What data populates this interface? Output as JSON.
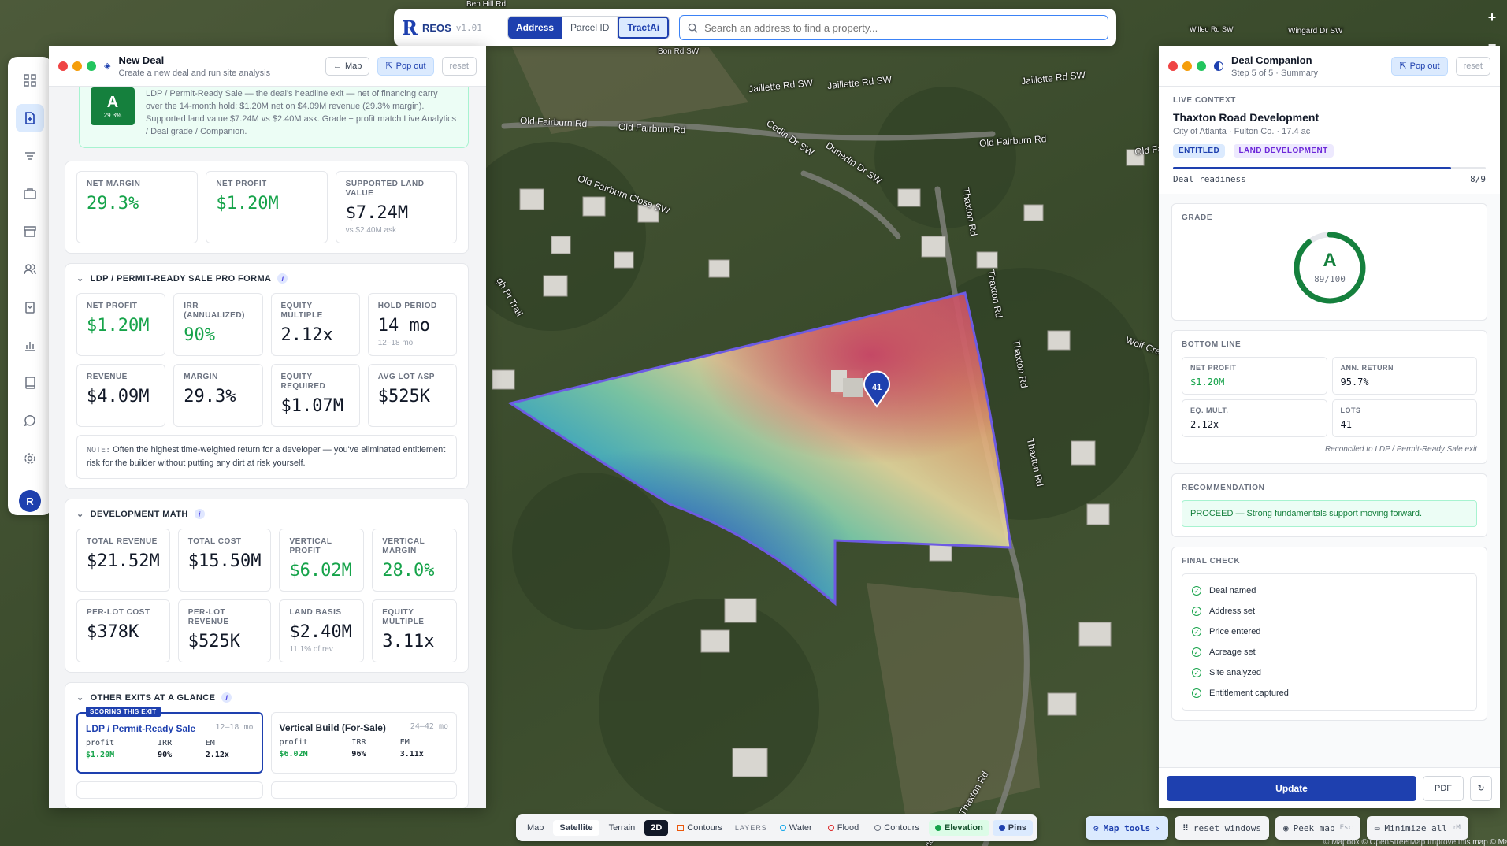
{
  "app": {
    "name": "REOS",
    "version": "v1.01"
  },
  "search": {
    "modes": [
      "Address",
      "Parcel ID",
      "TractAi"
    ],
    "placeholder": "Search an address to find a property..."
  },
  "map": {
    "pin_label": "41",
    "labels": [
      "Ben Hill Rd",
      "Jaillette Rd SW",
      "Jaillette Rd SW",
      "Old Fairburn Rd",
      "Old Fairburn Rd",
      "Old Fairburn Rd",
      "Cedin Dr SW",
      "Dunedin Dr SW",
      "Old Fairburn Close SW",
      "Thaxton Rd",
      "Thaxton Rd",
      "Thaxton Rd",
      "Thaxton Rd",
      "Thaxton Rd",
      "Wolf Cre",
      "gh Pt Trail",
      "Jaillette Rd SW",
      "Old Fairburn Rd",
      "Willeo Rd SW",
      "Wingard Dr SW",
      "Bon Rd SW",
      "Thaxton Rd"
    ],
    "attribution": "© Mapbox © OpenStreetMap Improve this map © Maxar"
  },
  "window_controls": {
    "add": "+",
    "minimize": "−"
  },
  "left_panel": {
    "title": "New Deal",
    "subtitle": "Create a new deal and run site analysis",
    "map_btn": "Map",
    "popout_btn": "Pop out",
    "reset_btn": "reset",
    "grade": {
      "letter": "A",
      "pct": "29.3%",
      "text": "LDP / Permit-Ready Sale — the deal's headline exit — net of financing carry over the 14-month hold: $1.20M net on $4.09M revenue (29.3% margin). Supported land value $7.24M vs $2.40M ask. Grade + profit match Live Analytics / Deal grade / Companion."
    },
    "headline": [
      {
        "label": "NET MARGIN",
        "value": "29.3%",
        "green": true,
        "sub": ""
      },
      {
        "label": "NET PROFIT",
        "value": "$1.20M",
        "green": true,
        "sub": ""
      },
      {
        "label": "SUPPORTED LAND VALUE",
        "value": "$7.24M",
        "green": false,
        "sub": "vs $2.40M ask"
      }
    ],
    "proforma": {
      "title": "LDP / PERMIT-READY SALE PRO FORMA",
      "metrics": [
        {
          "label": "NET PROFIT",
          "value": "$1.20M",
          "green": true,
          "sub": ""
        },
        {
          "label": "IRR (ANNUALIZED)",
          "value": "90%",
          "green": true,
          "sub": ""
        },
        {
          "label": "EQUITY MULTIPLE",
          "value": "2.12x",
          "green": false,
          "sub": ""
        },
        {
          "label": "HOLD PERIOD",
          "value": "14 mo",
          "green": false,
          "sub": "12–18 mo"
        },
        {
          "label": "REVENUE",
          "value": "$4.09M",
          "green": false,
          "sub": ""
        },
        {
          "label": "MARGIN",
          "value": "29.3%",
          "green": false,
          "sub": ""
        },
        {
          "label": "EQUITY REQUIRED",
          "value": "$1.07M",
          "green": false,
          "sub": ""
        },
        {
          "label": "AVG LOT ASP",
          "value": "$525K",
          "green": false,
          "sub": ""
        }
      ],
      "note_label": "NOTE:",
      "note": "Often the highest time-weighted return for a developer — you've eliminated entitlement risk for the builder without putting any dirt at risk yourself."
    },
    "devmath": {
      "title": "DEVELOPMENT MATH",
      "metrics": [
        {
          "label": "TOTAL REVENUE",
          "value": "$21.52M",
          "green": false,
          "sub": ""
        },
        {
          "label": "TOTAL COST",
          "value": "$15.50M",
          "green": false,
          "sub": ""
        },
        {
          "label": "VERTICAL PROFIT",
          "value": "$6.02M",
          "green": true,
          "sub": ""
        },
        {
          "label": "VERTICAL MARGIN",
          "value": "28.0%",
          "green": true,
          "sub": ""
        },
        {
          "label": "PER-LOT COST",
          "value": "$378K",
          "green": false,
          "sub": ""
        },
        {
          "label": "PER-LOT REVENUE",
          "value": "$525K",
          "green": false,
          "sub": ""
        },
        {
          "label": "LAND BASIS",
          "value": "$2.40M",
          "green": false,
          "sub": "11.1% of rev"
        },
        {
          "label": "EQUITY MULTIPLE",
          "value": "3.11x",
          "green": false,
          "sub": ""
        }
      ]
    },
    "exits": {
      "title": "OTHER EXITS AT A GLANCE",
      "tag": "SCORING THIS EXIT",
      "cols": [
        "profit",
        "IRR",
        "EM"
      ],
      "items": [
        {
          "name": "LDP / Permit-Ready Sale",
          "period": "12–18 mo",
          "profit": "$1.20M",
          "irr": "90%",
          "em": "2.12x"
        },
        {
          "name": "Vertical Build (For-Sale)",
          "period": "24–42 mo",
          "profit": "$6.02M",
          "irr": "96%",
          "em": "3.11x"
        }
      ]
    }
  },
  "right_panel": {
    "title": "Deal Companion",
    "subtitle": "Step 5 of 5 · Summary",
    "popout_btn": "Pop out",
    "reset_btn": "reset",
    "context_label": "LIVE CONTEXT",
    "deal_name": "Thaxton Road Development",
    "location": "City of Atlanta · Fulton Co. · 17.4 ac",
    "pills": [
      "ENTITLED",
      "LAND DEVELOPMENT"
    ],
    "readiness_label": "Deal readiness",
    "readiness_value": "8/9",
    "readiness_fraction": 0.889,
    "grade_label": "GRADE",
    "grade_letter": "A",
    "grade_score": "89/100",
    "grade_fraction": 0.89,
    "bottom_line_label": "BOTTOM LINE",
    "bottom_line": [
      {
        "label": "NET PROFIT",
        "value": "$1.20M",
        "green": true
      },
      {
        "label": "ANN. RETURN",
        "value": "95.7%",
        "green": false
      },
      {
        "label": "EQ. MULT.",
        "value": "2.12x",
        "green": false
      },
      {
        "label": "LOTS",
        "value": "41",
        "green": false
      }
    ],
    "reconciled": "Reconciled to LDP / Permit-Ready Sale exit",
    "recommendation_label": "RECOMMENDATION",
    "recommendation": "PROCEED — Strong fundamentals support moving forward.",
    "final_check_label": "FINAL CHECK",
    "checks": [
      "Deal named",
      "Address set",
      "Price entered",
      "Acreage set",
      "Site analyzed",
      "Entitlement captured"
    ],
    "update_btn": "Update",
    "pdf_btn": "PDF"
  },
  "bottom_bar": {
    "views": [
      "Map",
      "Satellite",
      "Terrain",
      "2D"
    ],
    "contours": "Contours",
    "layers_label": "LAYERS",
    "layers": [
      "Water",
      "Flood",
      "Contours",
      "Elevation",
      "Pins"
    ],
    "map_tools": "Map tools",
    "reset_windows": "reset windows",
    "peek_map": "Peek map",
    "peek_key": "Esc",
    "minimize_all": "Minimize all",
    "minimize_key": "⇧M"
  },
  "colors": {
    "accent": "#1e40af",
    "green": "#16a34a",
    "grade_ring": "#15803d"
  }
}
